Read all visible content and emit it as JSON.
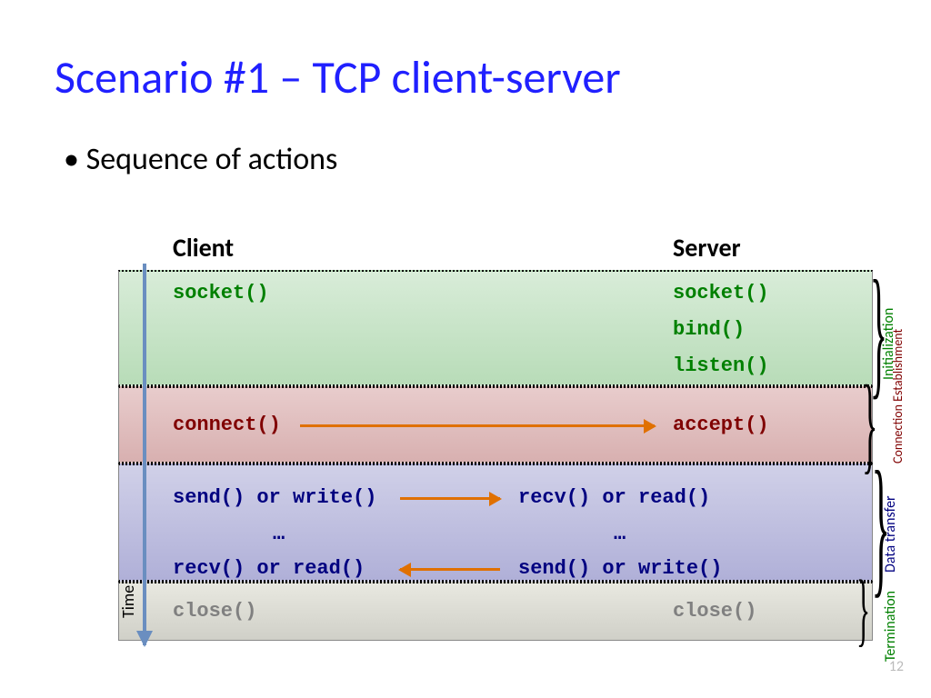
{
  "title": "Scenario #1 – TCP client-server",
  "bullet": "Sequence of actions",
  "headers": {
    "client": "Client",
    "server": "Server"
  },
  "client": {
    "socket": "socket()",
    "connect": "connect()",
    "send": "send() or write()",
    "dots": "…",
    "recv": "recv() or read()",
    "close": "close()"
  },
  "server": {
    "socket": "socket()",
    "bind": "bind()",
    "listen": "listen()",
    "accept": "accept()",
    "recv": "recv() or read()",
    "dots": "…",
    "send": "send() or write()",
    "close": "close()"
  },
  "labels": {
    "time": "Time",
    "init": "Initialization",
    "conn": "Connection Establishment",
    "data": "Data transfer",
    "term": "Termination"
  },
  "page": "12"
}
